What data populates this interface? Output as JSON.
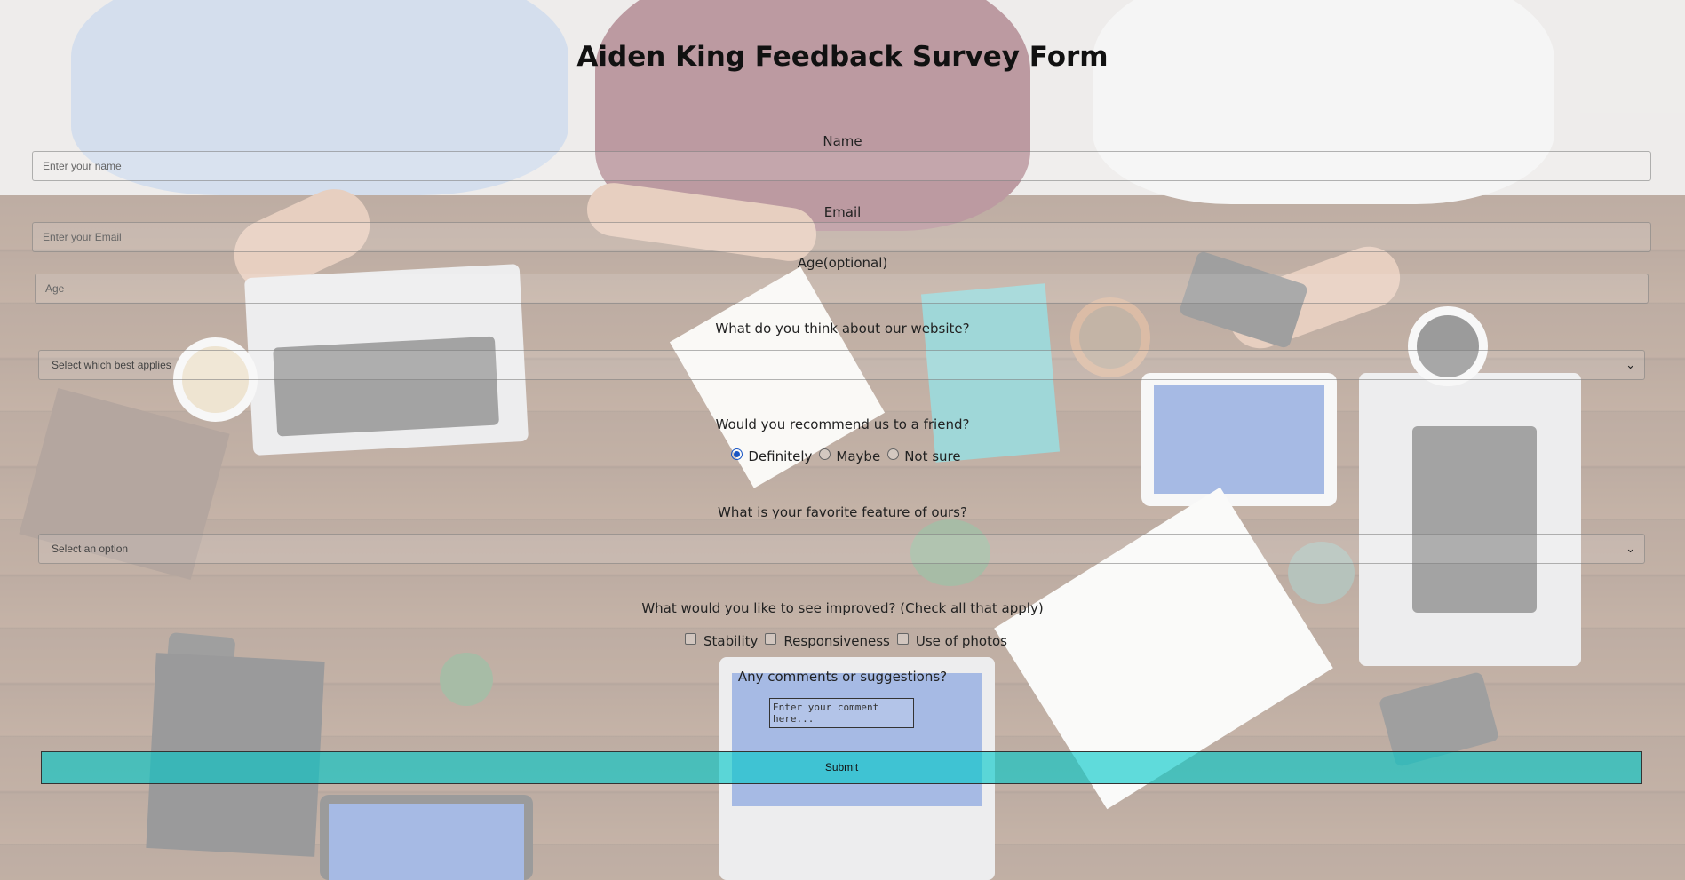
{
  "form": {
    "title": "Aiden King Feedback Survey Form",
    "name": {
      "label": "Name",
      "placeholder": "Enter your name"
    },
    "email": {
      "label": "Email",
      "placeholder": "Enter your Email"
    },
    "age": {
      "label": "Age(optional)",
      "placeholder": "Age"
    },
    "website_opinion": {
      "label": "What do you think about our website?",
      "selected": "Select which best applies"
    },
    "recommend": {
      "label": "Would you recommend us to a friend?",
      "options": [
        "Definitely",
        "Maybe",
        "Not sure"
      ],
      "selected": "Definitely"
    },
    "favorite_feature": {
      "label": "What is your favorite feature of ours?",
      "selected": "Select an option"
    },
    "improve": {
      "label": "What would you like to see improved? (Check all that apply)",
      "options": [
        "Stability",
        "Responsiveness",
        "Use of photos"
      ]
    },
    "comments": {
      "label": "Any comments or suggestions?",
      "placeholder": "Enter your comment here..."
    },
    "submit_label": "Submit"
  },
  "icons": {
    "select_arrow": "chevron-down-icon"
  },
  "colors": {
    "submit_bg": "#00c8c8",
    "radio_checked": "#1a56c4"
  }
}
